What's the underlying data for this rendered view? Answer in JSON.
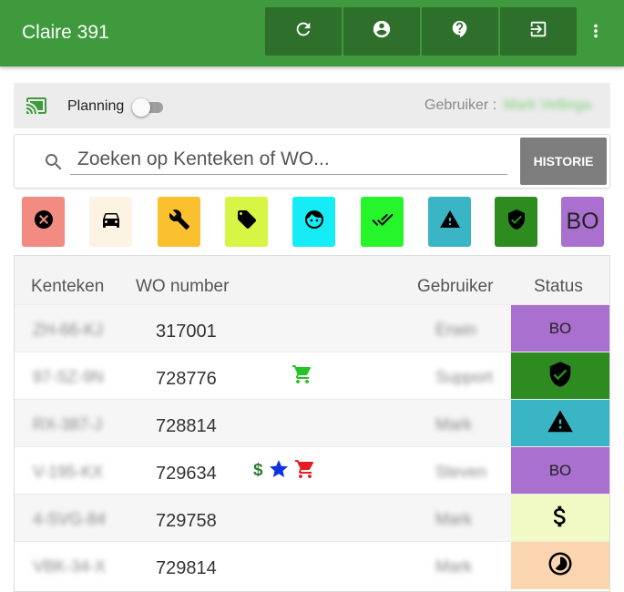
{
  "app": {
    "title": "Claire 391"
  },
  "appbar_actions": [
    {
      "name": "refresh-button",
      "icon": "refresh-icon"
    },
    {
      "name": "account-button",
      "icon": "account-circle-icon"
    },
    {
      "name": "help-button",
      "icon": "help-icon"
    },
    {
      "name": "logout-button",
      "icon": "exit-to-app-icon"
    }
  ],
  "planning": {
    "label": "Planning",
    "toggle_on": false,
    "user_label": "Gebruiker :",
    "user_value": "Mark Vellinga"
  },
  "search": {
    "placeholder": "Zoeken op Kenteken of WO...",
    "value": "",
    "history_button": "HISTORIE"
  },
  "filters": [
    {
      "name": "filter-cancelled",
      "icon": "cancel-icon",
      "color": "#f28b82"
    },
    {
      "name": "filter-car",
      "icon": "car-icon",
      "color": "#fdf3e3"
    },
    {
      "name": "filter-repair",
      "icon": "wrench-icon",
      "color": "#fbc02d"
    },
    {
      "name": "filter-label",
      "icon": "tag-icon",
      "color": "#d6f545"
    },
    {
      "name": "filter-face",
      "icon": "face-icon",
      "color": "#15ecf6"
    },
    {
      "name": "filter-done",
      "icon": "double-check-icon",
      "color": "#27f52c"
    },
    {
      "name": "filter-warning",
      "icon": "warning-icon",
      "color": "#3ab5c6"
    },
    {
      "name": "filter-verified",
      "icon": "verified-shield-icon",
      "color": "#2e8b1f"
    },
    {
      "name": "filter-bo",
      "label": "BO",
      "color": "#a970cf"
    }
  ],
  "table": {
    "headers": {
      "plate": "Kenteken",
      "wo": "WO number",
      "user": "Gebruiker",
      "status": "Status"
    },
    "rows": [
      {
        "plate": "ZH-66-KJ",
        "wo": "317001",
        "user": "Erwin",
        "status_label": "BO",
        "status_icon": "",
        "status_color": "#a970cf",
        "indicators": []
      },
      {
        "plate": "97-SZ-9N",
        "wo": "728776",
        "user": "Support",
        "status_label": "",
        "status_icon": "verified-shield-icon",
        "status_color": "#2e8b1f",
        "indicators": [
          "cart-green"
        ]
      },
      {
        "plate": "RX-387-J",
        "wo": "728814",
        "user": "Mark",
        "status_label": "",
        "status_icon": "warning-icon",
        "status_color": "#3ab5c6",
        "indicators": []
      },
      {
        "plate": "V-195-KX",
        "wo": "729634",
        "user": "Steven",
        "status_label": "BO",
        "status_icon": "",
        "status_color": "#a970cf",
        "indicators": [
          "dollar",
          "star-blue",
          "cart-red"
        ]
      },
      {
        "plate": "4-SVG-84",
        "wo": "729758",
        "user": "Mark",
        "status_label": "",
        "status_icon": "dollar-icon",
        "status_color": "#f1f9c4",
        "indicators": []
      },
      {
        "plate": "VBK-34-X",
        "wo": "729814",
        "user": "Mark",
        "status_label": "",
        "status_icon": "timelapse-icon",
        "status_color": "#fbd5b0",
        "indicators": []
      }
    ]
  }
}
